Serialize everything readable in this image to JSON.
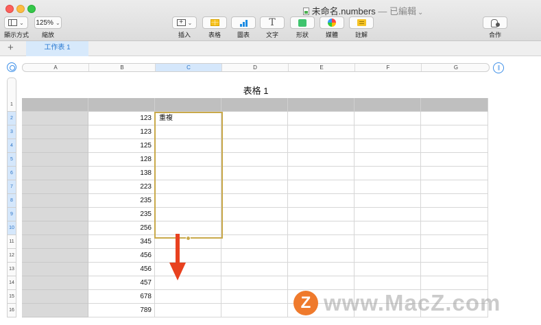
{
  "window": {
    "title": "未命名.numbers",
    "edited_suffix": " — 已編輯",
    "title_chevron": "⌄"
  },
  "toolbar": {
    "view_label": "顯示方式",
    "zoom_value": "125%",
    "zoom_label": "縮放",
    "insert_label": "插入",
    "table_label": "表格",
    "chart_label": "圖表",
    "text_label": "文字",
    "shape_label": "形狀",
    "media_label": "媒體",
    "comment_label": "註解",
    "collaborate_label": "合作",
    "insert_glyph": "+",
    "text_glyph": "T",
    "chevron": "⌄"
  },
  "sheets": {
    "add": "+",
    "tabs": [
      {
        "label": "工作表 1",
        "selected": true
      }
    ]
  },
  "columns": [
    "A",
    "B",
    "C",
    "D",
    "E",
    "F",
    "G"
  ],
  "selected_column": "C",
  "ruler_right_glyph": "||",
  "rows": [
    "1",
    "2",
    "3",
    "4",
    "5",
    "6",
    "7",
    "8",
    "9",
    "10",
    "11",
    "12",
    "13",
    "14",
    "15",
    "16"
  ],
  "selected_rows": [
    "2",
    "3",
    "4",
    "5",
    "6",
    "7",
    "8",
    "9",
    "10"
  ],
  "table": {
    "title": "表格 1",
    "column_b": [
      "123",
      "123",
      "125",
      "128",
      "138",
      "223",
      "235",
      "235",
      "256",
      "345",
      "456",
      "456",
      "457",
      "678",
      "789"
    ],
    "c2": "重複"
  },
  "watermark": {
    "logo_letter": "Z",
    "text": "www.MacZ.com"
  },
  "colors": {
    "accent_blue": "#3b8ee8",
    "selection_border": "#c9a94a",
    "arrow_red": "#e8411f",
    "header_gray": "#bfbfbf",
    "watermark_orange": "#ef7a2c"
  },
  "icons": {
    "view": "sidebar-view-icon",
    "insert": "insert-plus-icon",
    "table": "table-icon",
    "chart": "bar-chart-icon",
    "text": "text-t-icon",
    "shape": "shape-square-icon",
    "media": "media-flower-icon",
    "comment": "comment-note-icon",
    "collaborate": "collaborate-person-icon"
  }
}
